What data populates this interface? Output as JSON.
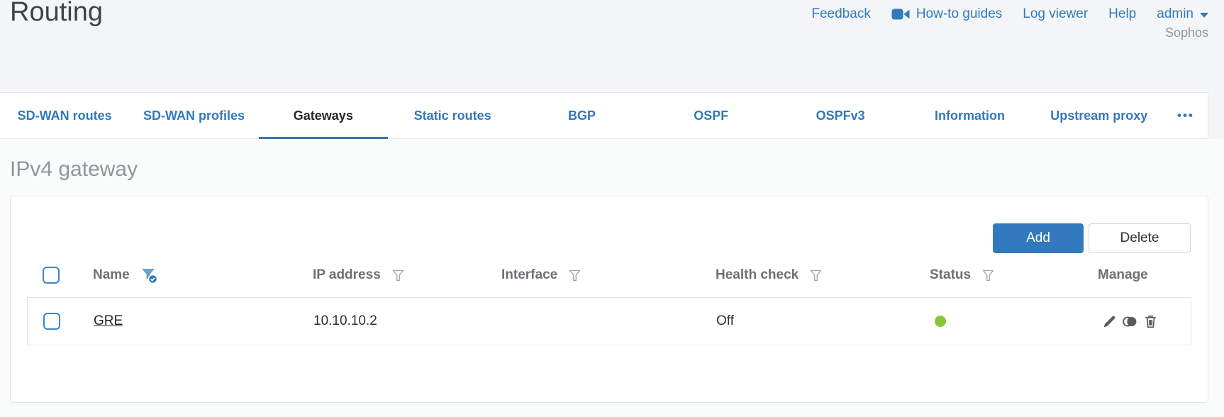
{
  "page_title": "Routing",
  "brand": "Sophos",
  "header_links": {
    "feedback": "Feedback",
    "howto": "How-to guides",
    "log_viewer": "Log viewer",
    "help": "Help",
    "user": "admin"
  },
  "tabs": [
    {
      "label": "SD-WAN routes",
      "active": false
    },
    {
      "label": "SD-WAN profiles",
      "active": false
    },
    {
      "label": "Gateways",
      "active": true
    },
    {
      "label": "Static routes",
      "active": false
    },
    {
      "label": "BGP",
      "active": false
    },
    {
      "label": "OSPF",
      "active": false
    },
    {
      "label": "OSPFv3",
      "active": false
    },
    {
      "label": "Information",
      "active": false
    },
    {
      "label": "Upstream proxy",
      "active": false
    }
  ],
  "tabs_more_glyph": "•••",
  "section_heading": "IPv4 gateway",
  "toolbar": {
    "add": "Add",
    "delete": "Delete"
  },
  "table": {
    "columns": [
      {
        "label": "Name",
        "filter": "active"
      },
      {
        "label": "IP address",
        "filter": "default"
      },
      {
        "label": "Interface",
        "filter": "default"
      },
      {
        "label": "Health check",
        "filter": "default"
      },
      {
        "label": "Status",
        "filter": "default"
      },
      {
        "label": "Manage",
        "filter": "none"
      }
    ],
    "rows": [
      {
        "name": "GRE",
        "ip_address": "10.10.10.2",
        "interface": "",
        "health_check": "Off",
        "status": "up",
        "selected": false
      }
    ]
  },
  "icons": {
    "howto": "video-camera",
    "user_caret": "chevron-down",
    "filter": "funnel",
    "filter_active": "funnel-with-check",
    "more_tabs": "ellipsis",
    "edit": "pencil",
    "clone": "clone",
    "delete": "trash",
    "status_up": "green-dot"
  },
  "colors": {
    "accent_blue": "#3279bd",
    "status_green": "#86c63c",
    "title_text": "#3c434a",
    "muted_text": "#8f969c",
    "panel_border": "#e3e6e8"
  }
}
